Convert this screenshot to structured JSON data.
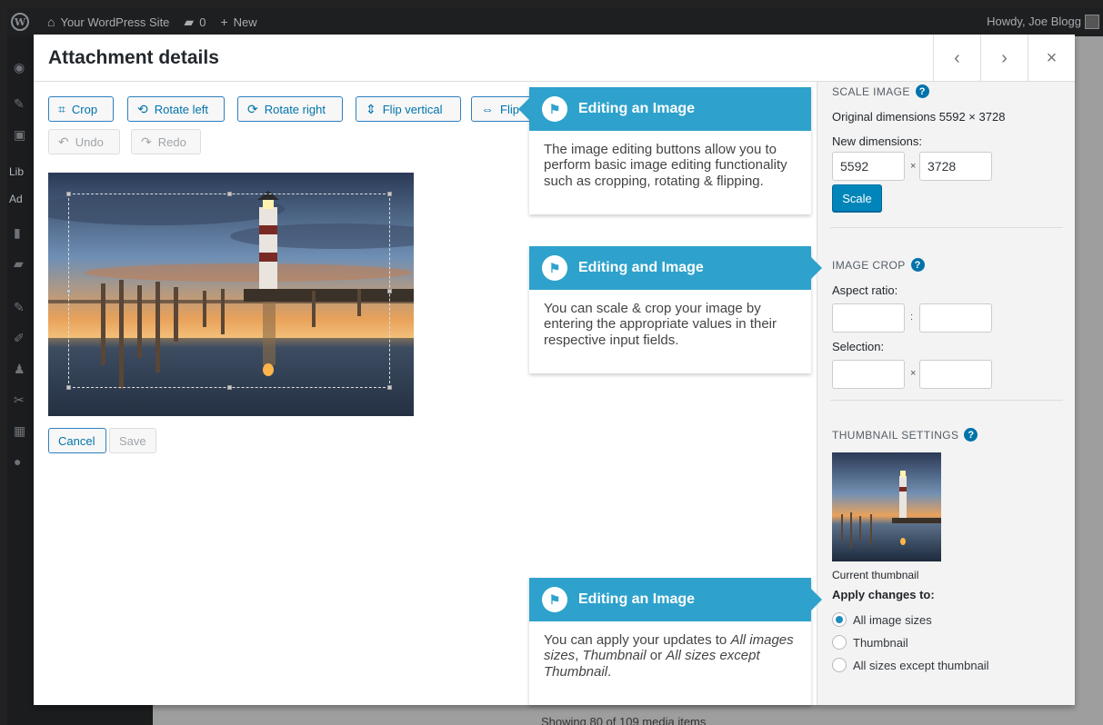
{
  "adminbar": {
    "site_name": "Your WordPress Site",
    "comments_count": "0",
    "new_label": "New",
    "howdy": "Howdy, Joe Blogg"
  },
  "sidemenu": {
    "lib_label": "Lib",
    "add_label": "Ad"
  },
  "modal": {
    "title": "Attachment details",
    "prev": "‹",
    "next": "›",
    "close": "×"
  },
  "toolbar": {
    "crop": "Crop",
    "rotate_left": "Rotate left",
    "rotate_right": "Rotate right",
    "flip_vertical": "Flip vertical",
    "flip_horizontal": "Flip",
    "undo": "Undo",
    "redo": "Redo"
  },
  "actions": {
    "cancel": "Cancel",
    "save": "Save"
  },
  "scale_image": {
    "heading": "SCALE IMAGE",
    "original": "Original dimensions 5592 × 3728",
    "new_dimensions_label": "New dimensions:",
    "width": "5592",
    "height": "3728",
    "times": "×",
    "scale_button": "Scale"
  },
  "image_crop": {
    "heading": "IMAGE CROP",
    "aspect_label": "Aspect ratio:",
    "aspect_sep": ":",
    "selection_label": "Selection:",
    "selection_sep": "×"
  },
  "thumbnail": {
    "heading": "THUMBNAIL SETTINGS",
    "current_label": "Current thumbnail",
    "apply_label": "Apply changes to:",
    "options": [
      "All image sizes",
      "Thumbnail",
      "All sizes except thumbnail"
    ],
    "selected_option": "All image sizes"
  },
  "pointers": [
    {
      "title": "Editing an Image",
      "body": "The image editing buttons allow you to perform basic image editing functionality such as cropping, rotating & flipping."
    },
    {
      "title": "Editing and Image",
      "body": "You can scale & crop your image by entering the appropriate values in their respective input fields."
    },
    {
      "title": "Editing an Image",
      "body_parts": [
        "You can apply your updates to ",
        "All images sizes",
        ", ",
        "Thumbnail",
        " or ",
        "All sizes except Thumbnail",
        "."
      ]
    }
  ],
  "footer": {
    "count_text": "Showing 80 of 109 media items"
  },
  "help_glyph": "?",
  "icons": {
    "wordpress": "wordpress-logo-icon",
    "home": "home-icon",
    "comment": "comment-icon",
    "plus": "plus-icon",
    "flag": "flag-icon"
  },
  "colors": {
    "accent": "#0073aa",
    "pointer_header": "#2ea2cc",
    "primary_button": "#0085ba",
    "admin_bar": "#1d1f21"
  }
}
